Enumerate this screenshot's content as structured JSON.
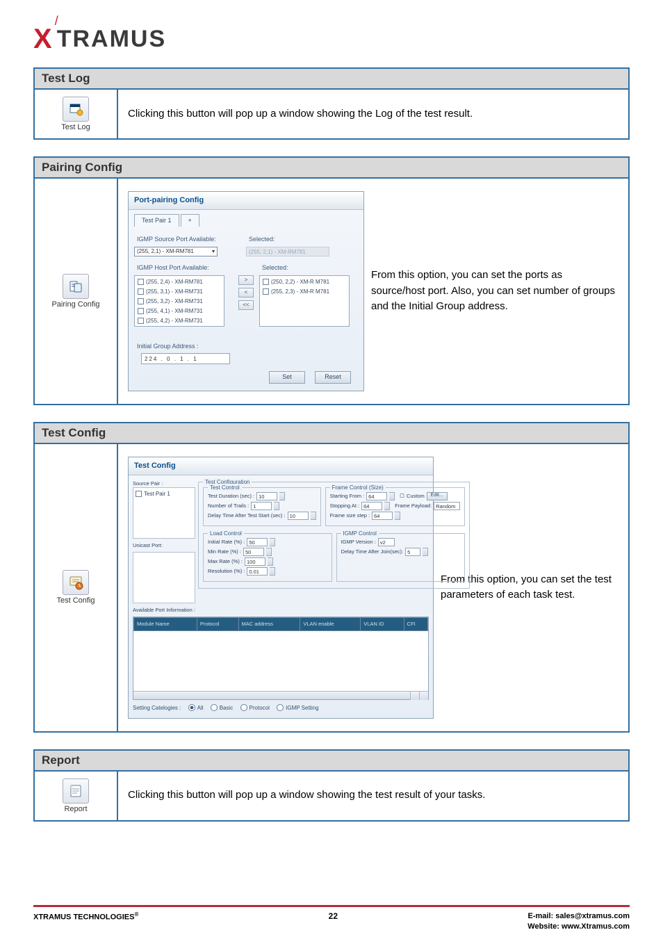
{
  "logo": {
    "x": "X",
    "rest": "TRAMUS"
  },
  "testlog": {
    "header": "Test Log",
    "icon_label": "Test Log",
    "desc": "Clicking this button will pop up a window showing the Log of the test result."
  },
  "pairing": {
    "header": "Pairing Config",
    "icon_label": "Pairing Config",
    "desc": "From this option, you can set the ports as source/host port. Also, you can set number of groups and the Initial Group address.",
    "panel": {
      "title": "Port-pairing Config",
      "tab1": "Test Pair 1",
      "tab_add": "+",
      "source_available_label": "IGMP Source Port Available:",
      "source_available_value": "(255, 2,1) - XM-RM781",
      "source_selected_label": "Selected:",
      "source_selected_value": "(255, 2,1) - XM-RM781",
      "host_available_label": "IGMP Host Port Available:",
      "host_available": [
        "(255, 2,4) - XM-RM781",
        "(255, 3,1) - XM-RM731",
        "(255, 3,2) - XM-RM731",
        "(255, 4,1) - XM-RM731",
        "(255, 4,2) - XM-RM731"
      ],
      "host_selected_label": "Selected:",
      "host_selected": [
        "(250, 2,2) - XM-R M781",
        "(255, 2,3) - XM-R M781"
      ],
      "move_r": ">",
      "move_l": "<",
      "move_ll": "<<",
      "initial_group_label": "Initial Group Address :",
      "initial_group_value": "224 . 0 . 1 . 1",
      "btn_set": "Set",
      "btn_reset": "Reset"
    }
  },
  "testconfig": {
    "header": "Test Config",
    "icon_label": "Test Config",
    "desc": "From this option, you can set the test parameters of each task test.",
    "panel": {
      "title": "Test Config",
      "source_pair_label": "Source Pair :",
      "source_pair_item": "Test Pair 1",
      "unicast_port_label": "Unicast Port:",
      "test_configuration_group": "Test Configuration",
      "test_control_group": "Test Control",
      "test_duration_label": "Test Duration (sec) :",
      "test_duration_value": "10",
      "number_trials_label": "Number of Trails :",
      "number_trials_value": "1",
      "delay_after_label": "Delay Time After Test Start (sec) :",
      "delay_after_value": "10",
      "frame_group": "Frame Control (Size)",
      "starting_from_label": "Starting From :",
      "starting_from_value": "64",
      "stopping_at_label": "Stopping At :",
      "stopping_at_value": "64",
      "frame_step_label": "Frame size step :",
      "frame_step_value": "64",
      "custom_label": "Custom",
      "edit_btn": "Edit...",
      "frame_payload_label": "Frame Payload:",
      "frame_payload_value": "Random",
      "load_group": "Load Control",
      "initial_rate_label": "Initial Rate (%) :",
      "initial_rate_value": "50",
      "min_rate_label": "Min Rate (%) :",
      "min_rate_value": "50",
      "max_rate_label": "Max Rate (%) :",
      "max_rate_value": "100",
      "resolution_label": "Resolution (%) :",
      "resolution_value": "0.01",
      "igmp_group": "IGMP Control",
      "igmp_version_label": "IGMP Version :",
      "igmp_version_value": "v2",
      "delay_join_label": "Delay Time After Join(sec):",
      "delay_join_value": "5",
      "available_info_label": "Available Port Information :",
      "th_module": "Module Name",
      "th_protocol": "Protocol",
      "th_mac": "MAC address",
      "th_vlan_en": "VLAN enable",
      "th_vlan_id": "VLAN ID",
      "th_cfi": "CFI",
      "radios_label": "Setting Catelogies :",
      "radio_all": "All",
      "radio_basic": "Basic",
      "radio_protocol": "Protocol",
      "radio_igmp": "IGMP Setting"
    }
  },
  "report": {
    "header": "Report",
    "icon_label": "Report",
    "desc": "Clicking this button will pop up a window showing the test result of your tasks."
  },
  "footer": {
    "left": "XTRAMUS TECHNOLOGIES",
    "page": "22",
    "email": "E-mail: sales@xtramus.com",
    "website": "Website:  www.Xtramus.com"
  }
}
